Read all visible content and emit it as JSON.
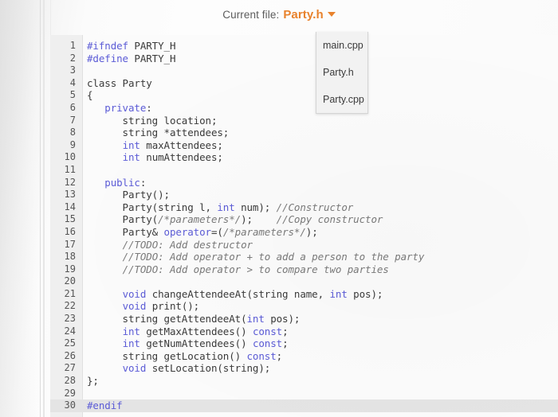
{
  "header": {
    "label": "Current file:",
    "current_file": "Party.h",
    "caret_icon": "chevron-down-icon",
    "accent_color": "#e8822c"
  },
  "file_dropdown": {
    "open": true,
    "options": [
      "main.cpp",
      "Party.h",
      "Party.cpp"
    ],
    "selected": "Party.h"
  },
  "editor": {
    "language": "cpp",
    "current_line": 30,
    "line_count": 30,
    "lines": [
      {
        "n": "1",
        "tokens": [
          {
            "t": "#ifndef ",
            "c": "pp"
          },
          {
            "t": "PARTY_H",
            "c": "pln"
          }
        ]
      },
      {
        "n": "2",
        "tokens": [
          {
            "t": "#define ",
            "c": "pp"
          },
          {
            "t": "PARTY_H",
            "c": "pln"
          }
        ]
      },
      {
        "n": "3",
        "tokens": []
      },
      {
        "n": "4",
        "tokens": [
          {
            "t": "class Party",
            "c": "pln"
          }
        ]
      },
      {
        "n": "5",
        "tokens": [
          {
            "t": "{",
            "c": "pln"
          }
        ]
      },
      {
        "n": "6",
        "tokens": [
          {
            "t": "   ",
            "c": "pln"
          },
          {
            "t": "private",
            "c": "kw"
          },
          {
            "t": ":",
            "c": "pln"
          }
        ]
      },
      {
        "n": "7",
        "tokens": [
          {
            "t": "      string location;",
            "c": "pln"
          }
        ]
      },
      {
        "n": "8",
        "tokens": [
          {
            "t": "      string *attendees;",
            "c": "pln"
          }
        ]
      },
      {
        "n": "9",
        "tokens": [
          {
            "t": "      ",
            "c": "pln"
          },
          {
            "t": "int",
            "c": "kw"
          },
          {
            "t": " maxAttendees;",
            "c": "pln"
          }
        ]
      },
      {
        "n": "10",
        "tokens": [
          {
            "t": "      ",
            "c": "pln"
          },
          {
            "t": "int",
            "c": "kw"
          },
          {
            "t": " numAttendees;",
            "c": "pln"
          }
        ]
      },
      {
        "n": "11",
        "tokens": []
      },
      {
        "n": "12",
        "tokens": [
          {
            "t": "   ",
            "c": "pln"
          },
          {
            "t": "public",
            "c": "kw"
          },
          {
            "t": ":",
            "c": "pln"
          }
        ]
      },
      {
        "n": "13",
        "tokens": [
          {
            "t": "      Party();",
            "c": "pln"
          }
        ]
      },
      {
        "n": "14",
        "tokens": [
          {
            "t": "      Party(string l, ",
            "c": "pln"
          },
          {
            "t": "int",
            "c": "kw"
          },
          {
            "t": " num); ",
            "c": "pln"
          },
          {
            "t": "//Constructor",
            "c": "cmt"
          }
        ]
      },
      {
        "n": "15",
        "tokens": [
          {
            "t": "      Party(",
            "c": "pln"
          },
          {
            "t": "/*parameters*/",
            "c": "cmt"
          },
          {
            "t": ");    ",
            "c": "pln"
          },
          {
            "t": "//Copy constructor",
            "c": "cmt"
          }
        ]
      },
      {
        "n": "16",
        "tokens": [
          {
            "t": "      Party& ",
            "c": "pln"
          },
          {
            "t": "operator",
            "c": "kw"
          },
          {
            "t": "=(",
            "c": "pln"
          },
          {
            "t": "/*parameters*/",
            "c": "cmt"
          },
          {
            "t": ");",
            "c": "pln"
          }
        ]
      },
      {
        "n": "17",
        "tokens": [
          {
            "t": "      ",
            "c": "pln"
          },
          {
            "t": "//TODO: Add destructor",
            "c": "cmt"
          }
        ]
      },
      {
        "n": "18",
        "tokens": [
          {
            "t": "      ",
            "c": "pln"
          },
          {
            "t": "//TODO: Add operator + to add a person to the party",
            "c": "cmt"
          }
        ]
      },
      {
        "n": "19",
        "tokens": [
          {
            "t": "      ",
            "c": "pln"
          },
          {
            "t": "//TODO: Add operator > to compare two parties",
            "c": "cmt"
          }
        ]
      },
      {
        "n": "20",
        "tokens": []
      },
      {
        "n": "21",
        "tokens": [
          {
            "t": "      ",
            "c": "pln"
          },
          {
            "t": "void",
            "c": "kw"
          },
          {
            "t": " changeAttendeeAt(string name, ",
            "c": "pln"
          },
          {
            "t": "int",
            "c": "kw"
          },
          {
            "t": " pos);",
            "c": "pln"
          }
        ]
      },
      {
        "n": "22",
        "tokens": [
          {
            "t": "      ",
            "c": "pln"
          },
          {
            "t": "void",
            "c": "kw"
          },
          {
            "t": " print();",
            "c": "pln"
          }
        ]
      },
      {
        "n": "23",
        "tokens": [
          {
            "t": "      string getAttendeeAt(",
            "c": "pln"
          },
          {
            "t": "int",
            "c": "kw"
          },
          {
            "t": " pos);",
            "c": "pln"
          }
        ]
      },
      {
        "n": "24",
        "tokens": [
          {
            "t": "      ",
            "c": "pln"
          },
          {
            "t": "int",
            "c": "kw"
          },
          {
            "t": " getMaxAttendees() ",
            "c": "pln"
          },
          {
            "t": "const",
            "c": "kw"
          },
          {
            "t": ";",
            "c": "pln"
          }
        ]
      },
      {
        "n": "25",
        "tokens": [
          {
            "t": "      ",
            "c": "pln"
          },
          {
            "t": "int",
            "c": "kw"
          },
          {
            "t": " getNumAttendees() ",
            "c": "pln"
          },
          {
            "t": "const",
            "c": "kw"
          },
          {
            "t": ";",
            "c": "pln"
          }
        ]
      },
      {
        "n": "26",
        "tokens": [
          {
            "t": "      string getLocation() ",
            "c": "pln"
          },
          {
            "t": "const",
            "c": "kw"
          },
          {
            "t": ";",
            "c": "pln"
          }
        ]
      },
      {
        "n": "27",
        "tokens": [
          {
            "t": "      ",
            "c": "pln"
          },
          {
            "t": "void",
            "c": "kw"
          },
          {
            "t": " setLocation(string);",
            "c": "pln"
          }
        ]
      },
      {
        "n": "28",
        "tokens": [
          {
            "t": "};",
            "c": "pln"
          }
        ]
      },
      {
        "n": "29",
        "tokens": []
      },
      {
        "n": "30",
        "tokens": [
          {
            "t": "#endif",
            "c": "pp"
          }
        ],
        "current": true
      }
    ]
  },
  "colors": {
    "keyword": "#5b5bd6",
    "comment": "#7a7a7a",
    "plain": "#3a3a3a",
    "gutter_bg": "#efefef",
    "editor_bg": "#fbfbfb",
    "current_line_bg": "#e4e4e4"
  }
}
